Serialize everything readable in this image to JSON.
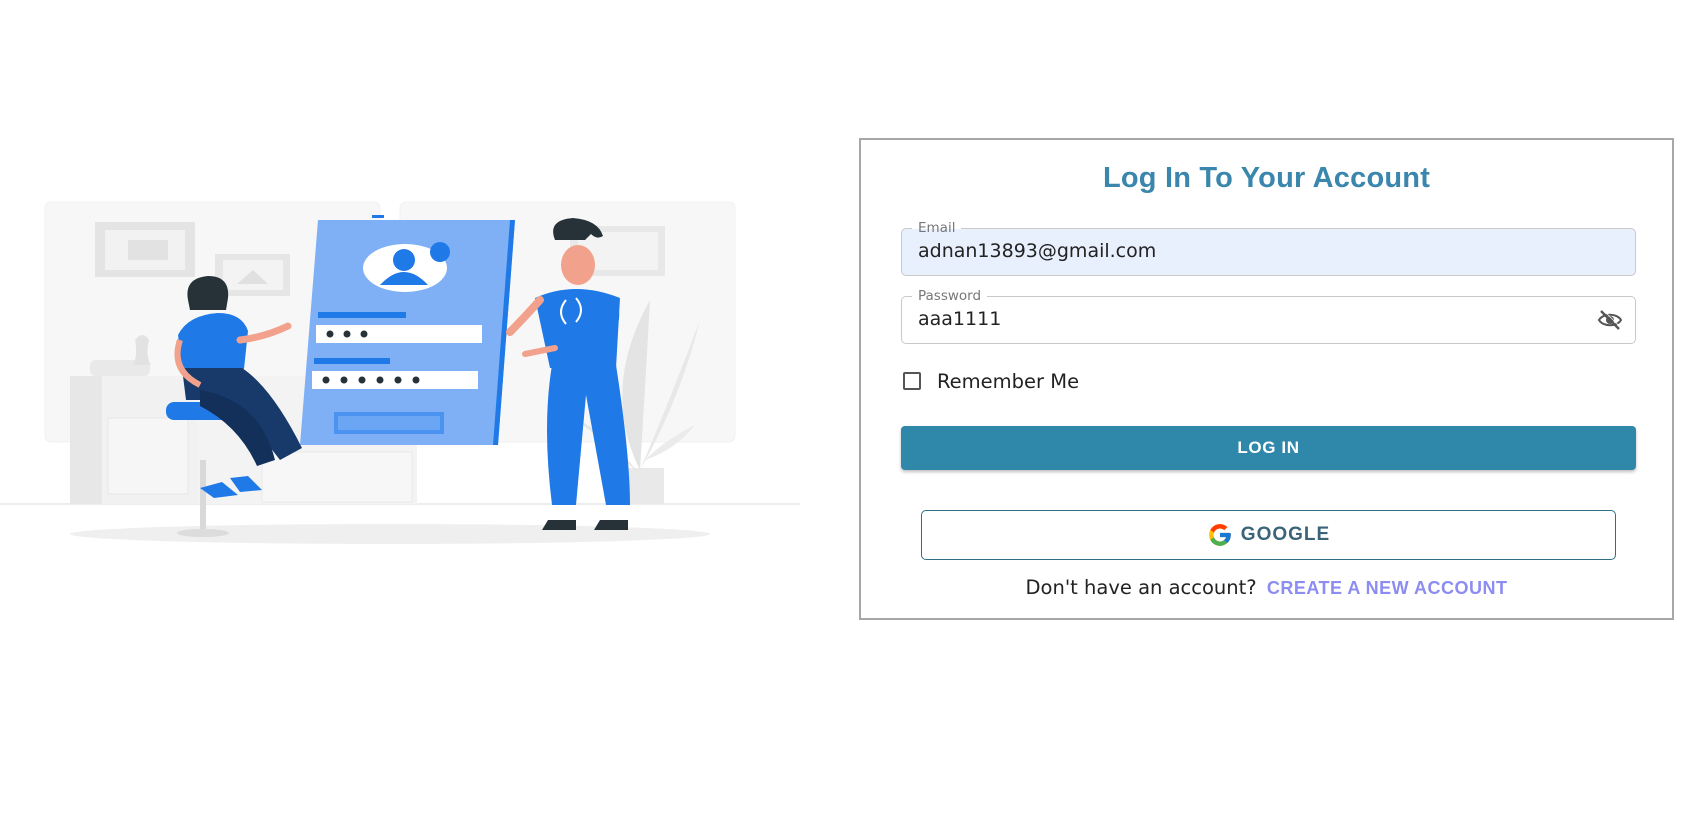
{
  "login": {
    "title": "Log In To Your Account",
    "email": {
      "label": "Email",
      "value": "adnan13893@gmail.com"
    },
    "password": {
      "label": "Password",
      "value": "aaa1111",
      "toggle_icon": "eye-off-icon"
    },
    "remember_label": "Remember Me",
    "remember_checked": false,
    "login_button": "LOG IN",
    "google_button": "GOOGLE",
    "signup_prompt": "Don't have an account?",
    "signup_link": "CREATE A NEW ACCOUNT"
  },
  "colors": {
    "accent": "#2f87aa",
    "title": "#3a86ac",
    "link": "#8c8cf2",
    "illustration_blue": "#1f7ae8"
  }
}
